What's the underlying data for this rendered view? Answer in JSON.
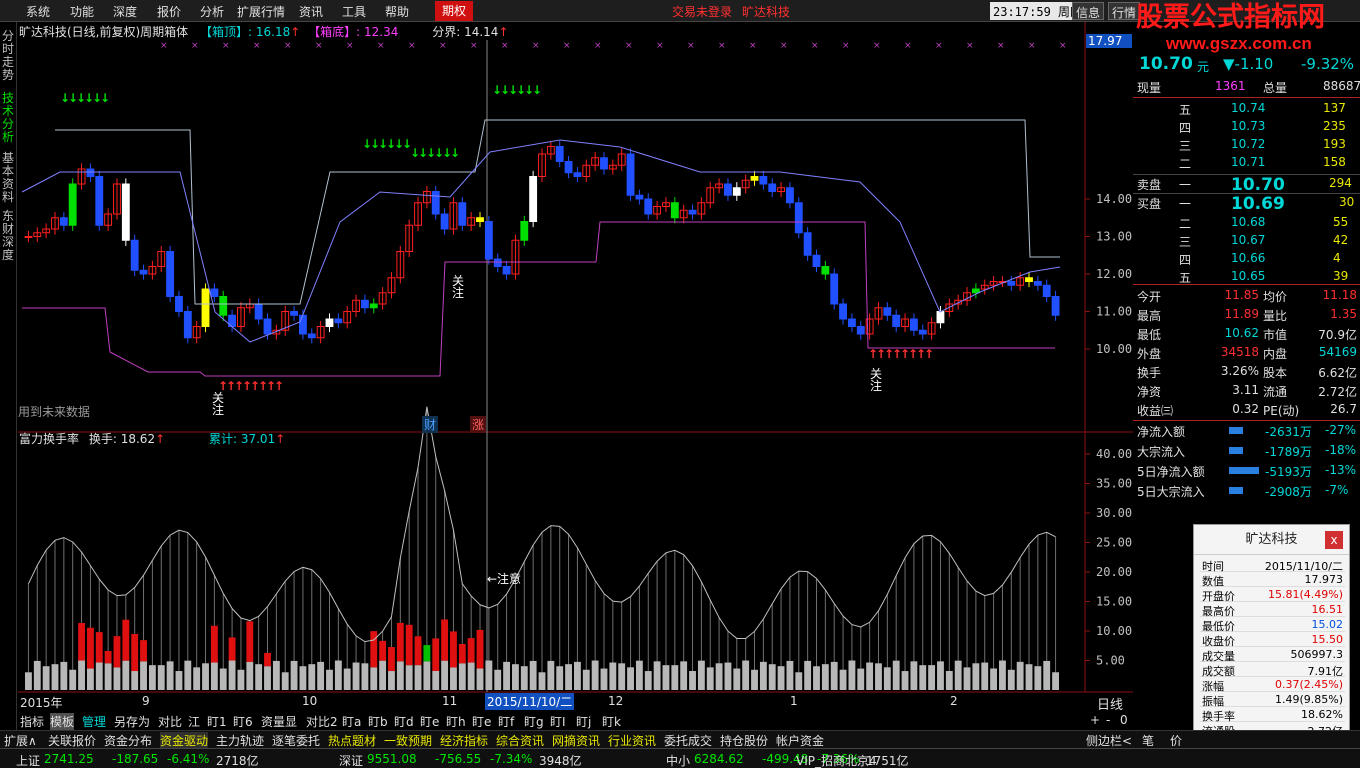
{
  "menu": {
    "items": [
      "系统",
      "功能",
      "深度",
      "报价",
      "分析",
      "扩展行情",
      "资讯",
      "工具",
      "帮助"
    ],
    "active": "期权",
    "notice": "交易未登录",
    "stock": "旷达科技",
    "clock": "23:17:59",
    "weekday": "周四",
    "right_buttons": [
      "信息",
      "行情"
    ]
  },
  "watermark": {
    "line1": "股票公式指标网",
    "line2": "www.gszx.com.cn"
  },
  "left_nav": [
    "分时走势",
    "技术分析",
    "基本资料",
    "东财深度"
  ],
  "main_chart": {
    "title": "旷达科技(日线,前复权)周期箱体",
    "box_top_label": "【箱顶】",
    "box_top_value": "16.18",
    "box_bottom_label": "【箱底】",
    "box_bottom_value": "12.34",
    "split_label": "分界",
    "split_value": "14.14",
    "future_data": "用到未来数据",
    "tag_cai": "财",
    "tag_zhang": "涨",
    "attention": "关注",
    "y_ticks": [
      "14.00",
      "13.00",
      "12.00",
      "11.00",
      "10.00"
    ],
    "cursor_price": "17.97"
  },
  "sub_chart": {
    "title": "富力换手率",
    "metric1_label": "换手",
    "metric1_value": "18.62",
    "metric2_label": "累计",
    "metric2_value": "37.01",
    "annot": "←注意",
    "y_ticks": [
      "40.00",
      "35.00",
      "30.00",
      "25.00",
      "20.00",
      "15.00",
      "10.00",
      "5.00"
    ]
  },
  "x_axis": {
    "labels": [
      "2015年",
      "9",
      "10",
      "11",
      "2015/11/10/二",
      "12",
      "1",
      "2"
    ],
    "period": "日线"
  },
  "chart_data": [
    {
      "type": "candlestick",
      "title": "旷达科技(日线,前复权)周期箱体",
      "ylim": [
        9.5,
        15.0
      ],
      "series": [
        {
          "name": "箱顶",
          "values": [
            16.18
          ]
        },
        {
          "name": "箱底",
          "values": [
            12.34
          ]
        },
        {
          "name": "分界",
          "values": [
            14.14
          ]
        }
      ],
      "cursor_date": "2015/11/10/二",
      "cursor_value": 17.97
    },
    {
      "type": "bar",
      "title": "富力换手率",
      "ylim": [
        0,
        42
      ],
      "series": [
        {
          "name": "换手",
          "values": [
            18.62
          ]
        },
        {
          "name": "累计",
          "values": [
            37.01
          ]
        }
      ]
    }
  ],
  "quote": {
    "price_top": "17.97",
    "price": "10.70",
    "unit": "元",
    "change": "▼-1.10",
    "change_pct": "-9.32%",
    "side_prices": [
      "10.69",
      "30",
      "10.70",
      "▼-1.10",
      "-9.32%",
      "1361"
    ],
    "now_label": "现量",
    "now_val": "1361",
    "total_label": "总量",
    "total_val": "88687",
    "sells": [
      {
        "label": "五",
        "price": "10.74",
        "vol": "137"
      },
      {
        "label": "四",
        "price": "10.73",
        "vol": "235"
      },
      {
        "label": "三",
        "price": "10.72",
        "vol": "193"
      },
      {
        "label": "二",
        "price": "10.71",
        "vol": "158"
      }
    ],
    "ask_label": "卖盘",
    "ask_idx": "一",
    "ask_price": "10.70",
    "ask_vol": "294",
    "bid_label": "买盘",
    "bid_idx": "一",
    "bid_price": "10.69",
    "bid_vol": "30",
    "buys": [
      {
        "label": "二",
        "price": "10.68",
        "vol": "55"
      },
      {
        "label": "三",
        "price": "10.67",
        "vol": "42"
      },
      {
        "label": "四",
        "price": "10.66",
        "vol": "4"
      },
      {
        "label": "五",
        "price": "10.65",
        "vol": "39"
      }
    ],
    "stats": [
      [
        "今开",
        "11.85",
        "均价",
        "11.18"
      ],
      [
        "最高",
        "11.89",
        "量比",
        "1.35"
      ],
      [
        "最低",
        "10.62",
        "市值",
        "70.9亿"
      ],
      [
        "外盘",
        "34518",
        "内盘",
        "54169"
      ],
      [
        "换手",
        "3.26%",
        "股本",
        "6.62亿"
      ],
      [
        "净资",
        "3.11",
        "流通",
        "2.72亿"
      ],
      [
        "收益㈢",
        "0.32",
        "PE(动)",
        "26.7"
      ]
    ],
    "flows": [
      [
        "净流入额",
        "-2631万",
        "-27%"
      ],
      [
        "大宗流入",
        "-1789万",
        "-18%"
      ],
      [
        "5日净流入额",
        "-5193万",
        "-13%"
      ],
      [
        "5日大宗流入",
        "-2908万",
        "-7%"
      ]
    ]
  },
  "popup": {
    "title": "旷达科技",
    "close": "x",
    "rows": [
      [
        "时间",
        "2015/11/10/二"
      ],
      [
        "数值",
        "17.973"
      ],
      [
        "开盘价",
        "15.81(4.49%)"
      ],
      [
        "最高价",
        "16.51"
      ],
      [
        "最低价",
        "15.02"
      ],
      [
        "收盘价",
        "15.50"
      ],
      [
        "成交量",
        "506997.3"
      ],
      [
        "成交额",
        "7.91亿"
      ],
      [
        "涨幅",
        "0.37(2.45%)"
      ],
      [
        "振幅",
        "1.49(9.85%)"
      ],
      [
        "换手率",
        "18.62%"
      ],
      [
        "流通股",
        "2.72亿"
      ]
    ]
  },
  "tabs1": [
    "指标",
    "模板",
    "管理",
    "另存为",
    "对比",
    "江",
    "盯1",
    "盯6",
    "资量显",
    "对比2",
    "盯a",
    "盯b",
    "盯d",
    "盯e",
    "盯h",
    "盯e",
    "盯f",
    "盯g",
    "盯I",
    "盯j",
    "盯k"
  ],
  "tabs1_right": [
    "+",
    "-",
    "0"
  ],
  "tabs2": [
    "扩展∧",
    "关联报价",
    "资金分布",
    "资金驱动",
    "主力轨迹",
    "逐笔委托",
    "热点题材",
    "一致预期",
    "经济指标",
    "综合资讯",
    "网摘资讯",
    "行业资讯",
    "委托成交",
    "持仓股份",
    "帐户资金"
  ],
  "tabs2_right": [
    "侧边栏<",
    "笔",
    "价"
  ],
  "status": {
    "items": [
      {
        "name": "上证",
        "val": "2741.25",
        "chg": "-187.65",
        "pct": "-6.41%",
        "amt": "2718亿"
      },
      {
        "name": "深证",
        "val": "9551.08",
        "chg": "-756.55",
        "pct": "-7.34%",
        "amt": "3948亿"
      },
      {
        "name": "中小",
        "val": "6284.62",
        "chg": "-499.48",
        "pct": "-7.36%",
        "amt": "1751亿"
      }
    ],
    "server": "VIP_招商北京4"
  }
}
